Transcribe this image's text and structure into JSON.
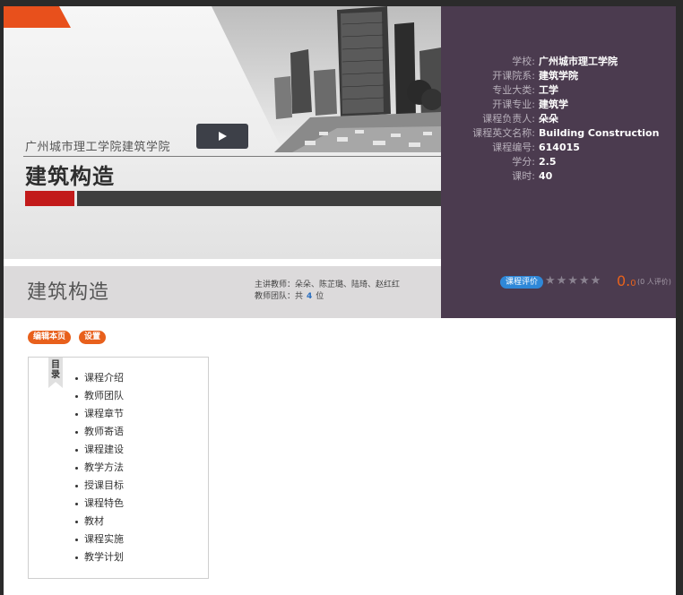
{
  "banner": {
    "school_line": "广州城市理工学院建筑学院",
    "course_title": "建筑构造"
  },
  "info": {
    "rows": [
      {
        "label": "学校:",
        "value": "广州城市理工学院"
      },
      {
        "label": "开课院系:",
        "value": "建筑学院"
      },
      {
        "label": "专业大类:",
        "value": "工学"
      },
      {
        "label": "开课专业:",
        "value": "建筑学"
      },
      {
        "label": "课程负责人:",
        "value": "朵朵"
      },
      {
        "label": "课程英文名称:",
        "value": "Building Construction"
      },
      {
        "label": "课程编号:",
        "value": "614015"
      },
      {
        "label": "学分:",
        "value": "2.5"
      },
      {
        "label": "课时:",
        "value": "40"
      }
    ],
    "rating_badge": "课程评价",
    "stars": "★★★★★",
    "score_main": "0.",
    "score_sub": "0",
    "rating_count": "(0 人评价)"
  },
  "course_bar": {
    "name": "建筑构造",
    "teachers_line": "主讲教师：朵朵、陈芷璐、陆琦、赵红红",
    "team_prefix": "教师团队：共",
    "team_count": "4",
    "team_suffix": "位"
  },
  "buttons": {
    "edit": "编辑本页",
    "settings": "设置"
  },
  "toc": {
    "ribbon": "目录",
    "items": [
      "课程介绍",
      "教师团队",
      "课程章节",
      "教师寄语",
      "课程建设",
      "教学方法",
      "授课目标",
      "课程特色",
      "教材",
      "课程实施",
      "教学计划"
    ]
  },
  "colors": {
    "accent_orange": "#e8601c",
    "panel_purple": "#4b3b4f",
    "badge_blue": "#2f88d8",
    "red_bar": "#c21a1a"
  }
}
